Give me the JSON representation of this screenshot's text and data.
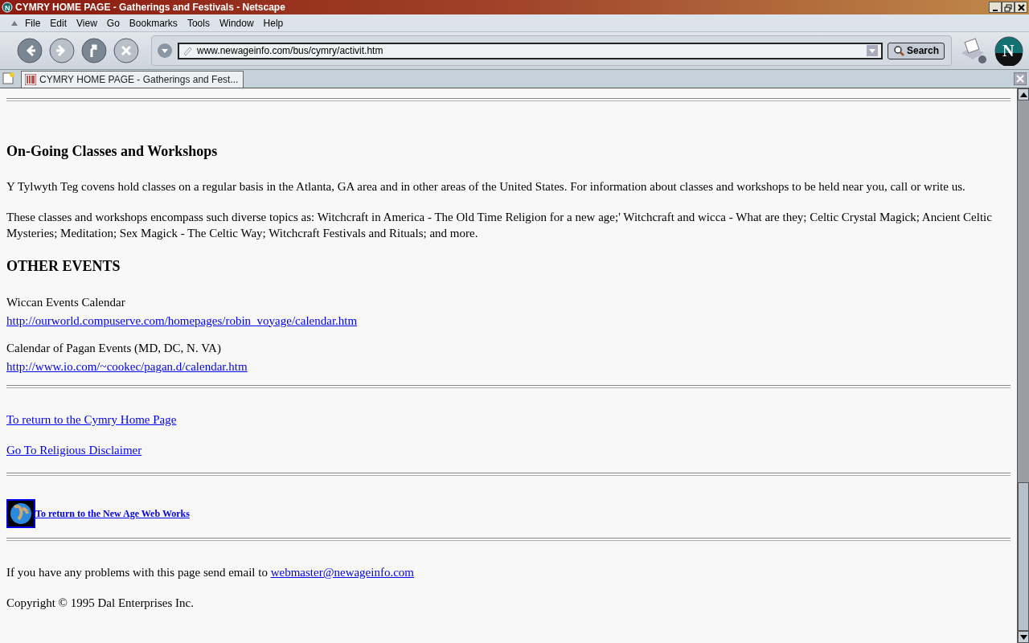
{
  "window": {
    "title": "CYMRY HOME PAGE - Gatherings and Festivals - Netscape",
    "logo_letter": "N"
  },
  "toolbar_logo": {
    "letter": "N"
  },
  "menu": [
    "File",
    "Edit",
    "View",
    "Go",
    "Bookmarks",
    "Tools",
    "Window",
    "Help"
  ],
  "nav_buttons": [
    {
      "kind": "back",
      "disabled": false
    },
    {
      "kind": "forward",
      "disabled": true
    },
    {
      "kind": "reload",
      "disabled": false
    },
    {
      "kind": "stop",
      "disabled": true
    }
  ],
  "address": {
    "value": "www.newageinfo.com/bus/cymry/activit.htm"
  },
  "search_button": "Search",
  "tabs": [
    {
      "label": "CYMRY HOME PAGE - Gatherings and Fest...",
      "selected": true
    }
  ],
  "content": [
    {
      "kind": "rule"
    },
    {
      "kind": "heading",
      "text": "On-Going Classes and Workshops"
    },
    {
      "kind": "paragraph",
      "text": "Y Tylwyth Teg covens hold classes on a regular basis in the Atlanta, GA area and in other areas of the United States. For information about classes and workshops to be held near you, call or write us."
    },
    {
      "kind": "paragraph",
      "text": "These classes and workshops encompass such diverse topics as: Witchcraft in America - The Old Time Religion for a new age;' Witchcraft and wicca - What are they; Celtic Crystal Magick; Ancient Celtic Mysteries; Meditation; Sex Magick - The Celtic Way; Witchcraft Festivals and Rituals; and more."
    },
    {
      "kind": "heading",
      "text": "OTHER EVENTS"
    },
    {
      "kind": "linkblock",
      "text": "Wiccan Events Calendar",
      "link": "http://ourworld.compuserve.com/homepages/robin_voyage/calendar.htm"
    },
    {
      "kind": "linkblock",
      "text": "Calendar of Pagan Events (MD, DC, N. VA)",
      "link": "http://www.io.com/~cookec/pagan.d/calendar.htm"
    },
    {
      "kind": "rule"
    },
    {
      "kind": "link",
      "link": "To return to the Cymry Home Page"
    },
    {
      "kind": "link",
      "link": "Go To Religious Disclaimer"
    },
    {
      "kind": "rule"
    },
    {
      "kind": "imagelink",
      "link": "To return to the New Age Web Works"
    },
    {
      "kind": "rule"
    },
    {
      "kind": "mailto",
      "text": "If you have any problems with this page send email to ",
      "link": "webmaster@newageinfo.com"
    },
    {
      "kind": "paragraph",
      "text": "Copyright © 1995 Dal Enterprises Inc."
    }
  ]
}
